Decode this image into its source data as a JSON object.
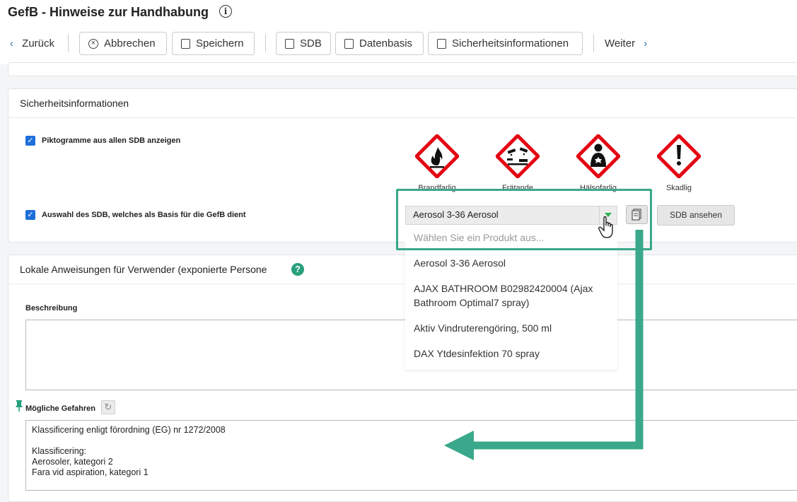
{
  "header": {
    "title": "GefB - Hinweise zur Handhabung",
    "toolbar": {
      "back_label": "Zurück",
      "cancel_label": "Abbrechen",
      "save_label": "Speichern",
      "sdb_label": "SDB",
      "database_label": "Datenbasis",
      "safety_info_label": "Sicherheitsinformationen",
      "next_label": "Weiter"
    }
  },
  "safety_card": {
    "title": "Sicherheitsinformationen",
    "show_pictograms_label": "Piktogramme aus allen SDB anzeigen",
    "show_pictograms_checked": true,
    "sdb_select_label": "Auswahl des SDB, welches als Basis für die GefB dient",
    "sdb_select_checked": true,
    "pictograms": [
      {
        "label": "Brandfarlig",
        "icon": "flame-icon"
      },
      {
        "label": "Frätande",
        "icon": "corrosion-icon"
      },
      {
        "label": "Hälsofarlig",
        "icon": "health-hazard-icon"
      },
      {
        "label": "Skadlig",
        "icon": "exclamation-icon"
      }
    ],
    "selected_product": "Aerosol 3-36 Aerosol",
    "view_sdb_label": "SDB ansehen"
  },
  "dropdown": {
    "placeholder": "Wählen Sie ein Produkt aus...",
    "options": [
      "Aerosol 3-36 Aerosol",
      "AJAX BATHROOM B02982420004 (Ajax\nBathroom Optimal7 spray)",
      "Aktiv Vindruterengöring, 500 ml",
      "DAX Ytdesinfektion 70 spray"
    ]
  },
  "local_card": {
    "title": "Lokale Anweisungen für Verwender (exponierte Persone",
    "description_label": "Beschreibung",
    "description_value": "",
    "hazards_label": "Mögliche Gefahren",
    "hazards_value": "Klassificering enligt förordning (EG) nr 1272/2008\n\nKlassificering:\nAerosoler, kategori 2\nFara vid aspiration, kategori 1"
  },
  "colors": {
    "accent": "#1e6fd9",
    "annotation": "#3aa88a",
    "ghs_red": "#e30613"
  }
}
